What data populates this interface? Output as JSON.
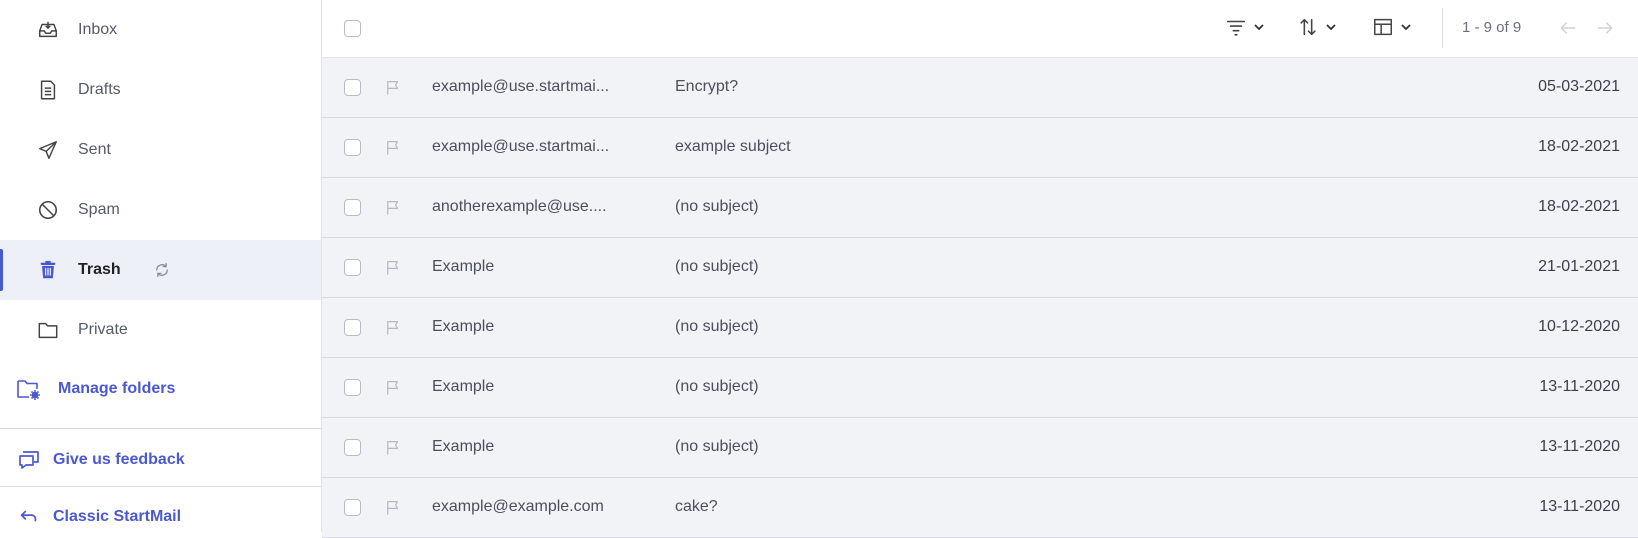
{
  "sidebar": {
    "folders": [
      {
        "label": "Inbox",
        "icon": "inbox-icon"
      },
      {
        "label": "Drafts",
        "icon": "drafts-icon"
      },
      {
        "label": "Sent",
        "icon": "sent-icon"
      },
      {
        "label": "Spam",
        "icon": "spam-icon"
      },
      {
        "label": "Trash",
        "icon": "trash-icon",
        "active": true
      },
      {
        "label": "Private",
        "icon": "folder-icon"
      }
    ],
    "manage_folders": "Manage folders",
    "feedback": "Give us feedback",
    "classic": "Classic StartMail"
  },
  "toolbar": {
    "pager": "1 - 9 of 9",
    "icons": [
      "filter-icon",
      "sort-icon",
      "layout-icon",
      "prev-arrow-icon",
      "next-arrow-icon"
    ]
  },
  "messages": [
    {
      "from": "example@use.startmai...",
      "subject": "Encrypt?",
      "date": "05-03-2021"
    },
    {
      "from": "example@use.startmai...",
      "subject": "example subject",
      "date": "18-02-2021"
    },
    {
      "from": "anotherexample@use....",
      "subject": "(no subject)",
      "date": "18-02-2021"
    },
    {
      "from": "Example",
      "subject": "(no subject)",
      "date": "21-01-2021"
    },
    {
      "from": "Example",
      "subject": "(no subject)",
      "date": "10-12-2020"
    },
    {
      "from": "Example",
      "subject": "(no subject)",
      "date": "13-11-2020"
    },
    {
      "from": "Example",
      "subject": "(no subject)",
      "date": "13-11-2020"
    },
    {
      "from": "example@example.com",
      "subject": "cake?",
      "date": "13-11-2020"
    }
  ],
  "colors": {
    "accent": "#4b59d1",
    "active_bg": "#eef0f8",
    "list_bg": "#f2f3f7"
  }
}
